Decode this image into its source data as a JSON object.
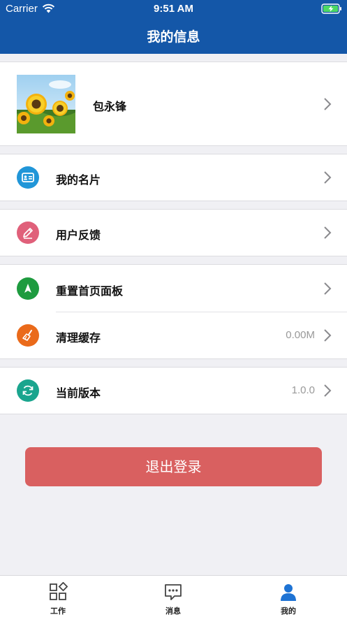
{
  "status_bar": {
    "carrier": "Carrier",
    "time": "9:51 AM"
  },
  "header": {
    "title": "我的信息"
  },
  "profile": {
    "name": "包永锋"
  },
  "menu": {
    "business_card": {
      "label": "我的名片",
      "icon": "id-card-icon",
      "color": "#2196d8"
    },
    "feedback": {
      "label": "用户反馈",
      "icon": "pencil-icon",
      "color": "#e0607a"
    },
    "reset_home": {
      "label": "重置首页面板",
      "icon": "navigation-arrow-icon",
      "color": "#1e9b3f"
    },
    "clear_cache": {
      "label": "清理缓存",
      "value": "0.00M",
      "icon": "broom-icon",
      "color": "#ea6a1a"
    },
    "version": {
      "label": "当前版本",
      "value": "1.0.0",
      "icon": "refresh-icon",
      "color": "#1aa58e"
    }
  },
  "logout": {
    "label": "退出登录",
    "color": "#d96060"
  },
  "tabbar": {
    "tabs": [
      {
        "label": "工作",
        "icon": "grid-icon"
      },
      {
        "label": "消息",
        "icon": "chat-icon"
      },
      {
        "label": "我的",
        "icon": "person-icon",
        "active": true
      }
    ],
    "active_color": "#1e73d4"
  },
  "colors": {
    "header_bg": "#1457a8",
    "page_bg": "#f0f0f4"
  }
}
